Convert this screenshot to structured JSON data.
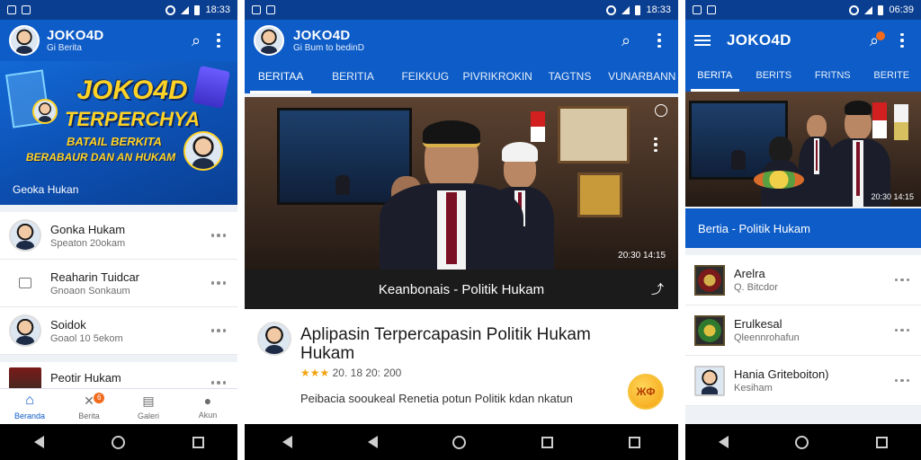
{
  "phone1": {
    "status": {
      "time": "18:33"
    },
    "appbar": {
      "title": "JOKO4D",
      "subtitle": "Gi Berita"
    },
    "hero": {
      "line1": "JOKO4D",
      "line2": "TERPERCHYA",
      "line3": "BATAIL BERKITA",
      "line4": "BERABAUR DAN AN HUKAM",
      "caption": "Geoka Hukan"
    },
    "list": [
      {
        "title": "Gonka Hukam",
        "sub": "Speaton 20okam"
      },
      {
        "title": "Reaharin Tuidcar",
        "sub": "Gnoaon Sonkaum"
      },
      {
        "title": "Soidok",
        "sub": "Goaol 10 5ekom"
      },
      {
        "title": "Peotir Hukam",
        "sub": ""
      }
    ],
    "bottom_nav": [
      {
        "label": "Beranda",
        "icon": "home-icon",
        "active": true
      },
      {
        "label": "Berita",
        "icon": "news-icon",
        "badge": "6"
      },
      {
        "label": "Galeri",
        "icon": "gallery-icon"
      },
      {
        "label": "Akun",
        "icon": "profile-icon"
      }
    ]
  },
  "phone2": {
    "status": {
      "time": "18:33"
    },
    "appbar": {
      "title": "JOKO4D",
      "subtitle": "Gi Bum to bedinD"
    },
    "tabs": [
      "BERITAA",
      "BERITIA",
      "FEIKKUG",
      "PIVRIKROKIN",
      "TAGTNS",
      "VUNARBANN"
    ],
    "photo_stamp": "20:30 14:15",
    "caption": "Keanbonais - Politik Hukam",
    "article": {
      "title": "Aplipasin Terpercapasin Politik Hukam Hukam",
      "meta": "20. 18 20: 200",
      "body": "Peibacia sooukeal Renetia potun Politik kdan nkatun",
      "stars": "★★★"
    },
    "fab": "ЖФ"
  },
  "phone3": {
    "status": {
      "time": "06:39"
    },
    "appbar": {
      "title": "JOKO4D"
    },
    "tabs": [
      "BERITA",
      "BERITS",
      "FRITNS",
      "BERITE"
    ],
    "photo_stamp": "20:30 14:15",
    "section_label": "Bertia - Politik Hukam",
    "list": [
      {
        "title": "Arelra",
        "sub": "Q. Bitcdor"
      },
      {
        "title": "Erulkesal",
        "sub": "Qleennrohafun"
      },
      {
        "title": "Hania Griteboiton)",
        "sub": "Kesiham"
      }
    ]
  }
}
